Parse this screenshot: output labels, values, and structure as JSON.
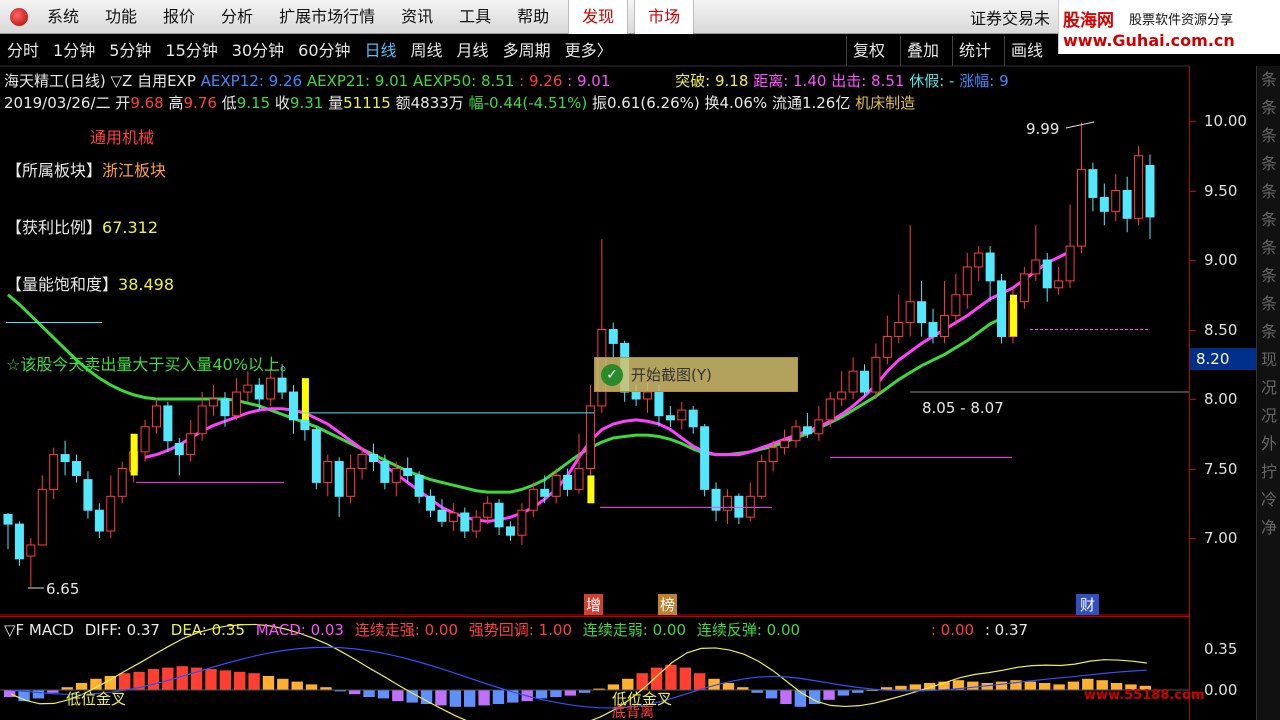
{
  "menu": {
    "items": [
      "系统",
      "功能",
      "报价",
      "分析",
      "扩展市场行情",
      "资讯",
      "工具",
      "帮助"
    ],
    "hot": [
      "发现",
      "市场"
    ],
    "right_title": "证券交易未"
  },
  "brand": {
    "name_prefix": "股海",
    "name_suffix": "网",
    "slogan": "股票软件资源分享",
    "url": "www.Guhai.com.cn"
  },
  "periods": {
    "items": [
      "分时",
      "1分钟",
      "5分钟",
      "15分钟",
      "30分钟",
      "60分钟",
      "日线",
      "周线",
      "月线",
      "多周期",
      "更多"
    ],
    "active_index": 6,
    "more_arrow": "〉"
  },
  "tools": [
    "复权",
    "叠加",
    "统计",
    "画线"
  ],
  "header": {
    "stock": "海天精工(日线)",
    "formula": "▽Z 自用EXP",
    "aexp12": "AEXP12: 9.26",
    "aexp21": "AEXP21: 9.01",
    "aexp50": "AEXP50: 8.51",
    "v1": ": 9.26",
    "v2": ": 9.01",
    "break": "突破: 9.18",
    "distance": "距离: 1.40",
    "exit": "出击: 8.51",
    "rest": "休假: -",
    "rise": "涨幅: 9"
  },
  "quote": {
    "date": "2019/03/26/二",
    "open_label": "开",
    "open": "9.68",
    "high_label": "高",
    "high": "9.76",
    "low_label": "低",
    "low": "9.15",
    "close_label": "收",
    "close": "9.31",
    "vol_label": "量",
    "vol": "51115",
    "amount": "额4833万",
    "change": "幅-0.44(-4.51%)",
    "amplitude": "振0.61(6.26%)",
    "turnover": "换4.06%",
    "float": "流通1.26亿",
    "industry": "机床制造"
  },
  "overlays": {
    "sector_tag": "通用机械",
    "block_label": "【所属板块】",
    "block_value": "浙江板块",
    "profit_label": "【获利比例】",
    "profit_value": "67.312",
    "energy_label": "【量能饱和度】",
    "energy_value": "38.498",
    "alert": "☆该股今天卖出量大于买入量40%以上。",
    "high_mark": "9.99",
    "low_mark": "6.65",
    "range_label": "8.05 - 8.07",
    "flag_zeng": "增",
    "flag_bang": "榜",
    "flag_cai": "财",
    "macd_tag1": "低位金叉",
    "macd_tag2": "低位金叉",
    "macd_tag3": "底背离"
  },
  "tooltip": {
    "label": "开始截图(Y)"
  },
  "axis": {
    "ticks": [
      "10.00",
      "9.50",
      "9.00",
      "8.50",
      "8.00",
      "7.50",
      "7.00"
    ],
    "current": "8.20",
    "macd_ticks": [
      "0.35",
      "0.00"
    ]
  },
  "sidebar": {
    "chars": [
      "条",
      "条",
      "条",
      "条",
      "条",
      "条",
      "条",
      "条",
      "条",
      "条",
      "现",
      "况",
      "况",
      "外",
      "拧",
      "冷",
      "净"
    ]
  },
  "macd": {
    "title": "▽F MACD",
    "diff": "DIFF: 0.37",
    "dea": "DEA: 0.35",
    "macd": "MACD: 0.03",
    "s1": "连续走强: 0.00",
    "s2": "强势回调: 1.00",
    "s3": "连续走弱: 0.00",
    "s4": "连续反弹: 0.00",
    "r1": ": 0.00",
    "r2": ": 0.37"
  },
  "watermark": "www.55188.com",
  "colors": {
    "up": "#ff3c3c",
    "down": "#54e8ff",
    "ma_green": "#3cd83c",
    "ma_magenta": "#ff40ff",
    "ma_blue": "#3050ff",
    "axis_red": "#c00000",
    "highlight_yellow": "#ffff00"
  },
  "price_scale": {
    "min": 6.6,
    "max": 10.0
  },
  "candles": [
    [
      7.17,
      7.1,
      7.18,
      6.92
    ],
    [
      7.1,
      6.85,
      7.12,
      6.8
    ],
    [
      6.87,
      6.95,
      7.0,
      6.65
    ],
    [
      6.95,
      7.35,
      7.45,
      6.95
    ],
    [
      7.35,
      7.6,
      7.65,
      7.28
    ],
    [
      7.6,
      7.55,
      7.7,
      7.45
    ],
    [
      7.55,
      7.45,
      7.6,
      7.4
    ],
    [
      7.42,
      7.2,
      7.48,
      7.14
    ],
    [
      7.2,
      7.05,
      7.25,
      7.0
    ],
    [
      7.05,
      7.3,
      7.45,
      7.0
    ],
    [
      7.3,
      7.5,
      7.55,
      7.25
    ],
    [
      7.48,
      7.62,
      7.7,
      7.4
    ],
    [
      7.62,
      7.8,
      7.85,
      7.55
    ],
    [
      7.8,
      7.95,
      8.0,
      7.75
    ],
    [
      7.95,
      7.7,
      7.98,
      7.62
    ],
    [
      7.68,
      7.6,
      7.72,
      7.45
    ],
    [
      7.6,
      7.75,
      7.85,
      7.55
    ],
    [
      7.75,
      7.95,
      8.05,
      7.7
    ],
    [
      7.95,
      8.0,
      8.1,
      7.88
    ],
    [
      8.0,
      7.88,
      8.05,
      7.8
    ],
    [
      7.88,
      8.05,
      8.15,
      7.85
    ],
    [
      8.05,
      8.1,
      8.2,
      7.98
    ],
    [
      8.1,
      8.0,
      8.15,
      7.92
    ],
    [
      8.0,
      8.15,
      8.22,
      7.95
    ],
    [
      8.15,
      8.05,
      8.25,
      8.0
    ],
    [
      8.05,
      7.85,
      8.1,
      7.75
    ],
    [
      7.85,
      7.78,
      7.9,
      7.7
    ],
    [
      7.78,
      7.4,
      7.8,
      7.35
    ],
    [
      7.4,
      7.55,
      7.6,
      7.3
    ],
    [
      7.55,
      7.3,
      7.58,
      7.15
    ],
    [
      7.3,
      7.5,
      7.6,
      7.25
    ],
    [
      7.5,
      7.6,
      7.65,
      7.42
    ],
    [
      7.6,
      7.55,
      7.68,
      7.48
    ],
    [
      7.55,
      7.4,
      7.6,
      7.35
    ],
    [
      7.4,
      7.5,
      7.55,
      7.3
    ],
    [
      7.5,
      7.45,
      7.58,
      7.4
    ],
    [
      7.45,
      7.3,
      7.48,
      7.25
    ],
    [
      7.3,
      7.2,
      7.35,
      7.15
    ],
    [
      7.2,
      7.12,
      7.28,
      7.08
    ],
    [
      7.12,
      7.18,
      7.25,
      7.05
    ],
    [
      7.18,
      7.05,
      7.22,
      7.0
    ],
    [
      7.05,
      7.15,
      7.2,
      7.0
    ],
    [
      7.15,
      7.25,
      7.3,
      7.1
    ],
    [
      7.25,
      7.08,
      7.28,
      7.02
    ],
    [
      7.08,
      7.02,
      7.12,
      6.98
    ],
    [
      7.02,
      7.2,
      7.25,
      6.95
    ],
    [
      7.2,
      7.35,
      7.4,
      7.15
    ],
    [
      7.35,
      7.3,
      7.45,
      7.25
    ],
    [
      7.3,
      7.45,
      7.5,
      7.25
    ],
    [
      7.45,
      7.35,
      7.5,
      7.3
    ],
    [
      7.35,
      7.5,
      7.75,
      7.32
    ],
    [
      7.5,
      7.95,
      8.1,
      7.45
    ],
    [
      7.95,
      8.5,
      9.15,
      7.9
    ],
    [
      8.5,
      8.4,
      8.55,
      8.3
    ],
    [
      8.4,
      8.05,
      8.42,
      7.98
    ],
    [
      8.05,
      8.0,
      8.1,
      7.95
    ],
    [
      8.0,
      8.05,
      8.12,
      7.9
    ],
    [
      8.05,
      7.88,
      8.1,
      7.8
    ],
    [
      7.88,
      7.85,
      7.95,
      7.8
    ],
    [
      7.85,
      7.92,
      7.98,
      7.78
    ],
    [
      7.92,
      7.8,
      7.95,
      7.75
    ],
    [
      7.8,
      7.35,
      7.82,
      7.3
    ],
    [
      7.35,
      7.2,
      7.4,
      7.12
    ],
    [
      7.2,
      7.3,
      7.35,
      7.1
    ],
    [
      7.3,
      7.15,
      7.32,
      7.1
    ],
    [
      7.15,
      7.3,
      7.4,
      7.12
    ],
    [
      7.3,
      7.55,
      7.6,
      7.28
    ],
    [
      7.55,
      7.65,
      7.7,
      7.48
    ],
    [
      7.65,
      7.7,
      7.78,
      7.6
    ],
    [
      7.7,
      7.8,
      7.85,
      7.65
    ],
    [
      7.8,
      7.75,
      7.9,
      7.72
    ],
    [
      7.75,
      7.85,
      7.95,
      7.7
    ],
    [
      7.85,
      8.0,
      8.05,
      7.8
    ],
    [
      8.0,
      8.05,
      8.2,
      7.95
    ],
    [
      8.05,
      8.2,
      8.3,
      8.0
    ],
    [
      8.2,
      8.05,
      8.25,
      8.02
    ],
    [
      8.05,
      8.3,
      8.4,
      8.0
    ],
    [
      8.3,
      8.45,
      8.6,
      8.25
    ],
    [
      8.45,
      8.55,
      8.75,
      8.4
    ],
    [
      8.55,
      8.7,
      9.25,
      8.45
    ],
    [
      8.7,
      8.55,
      8.85,
      8.45
    ],
    [
      8.55,
      8.45,
      8.65,
      8.4
    ],
    [
      8.45,
      8.6,
      8.85,
      8.4
    ],
    [
      8.6,
      8.75,
      8.9,
      8.55
    ],
    [
      8.75,
      8.95,
      9.05,
      8.65
    ],
    [
      8.95,
      9.05,
      9.1,
      8.85
    ],
    [
      9.05,
      8.85,
      9.1,
      8.7
    ],
    [
      8.85,
      8.45,
      8.9,
      8.4
    ],
    [
      8.45,
      8.7,
      8.8,
      8.4
    ],
    [
      8.7,
      8.9,
      8.95,
      8.65
    ],
    [
      8.9,
      9.0,
      9.25,
      8.85
    ],
    [
      9.0,
      8.8,
      9.05,
      8.7
    ],
    [
      8.8,
      8.85,
      8.95,
      8.75
    ],
    [
      8.85,
      9.1,
      9.4,
      8.8
    ],
    [
      9.1,
      9.65,
      9.99,
      9.05
    ],
    [
      9.65,
      9.45,
      9.7,
      9.35
    ],
    [
      9.45,
      9.35,
      9.55,
      9.25
    ],
    [
      9.35,
      9.5,
      9.62,
      9.28
    ],
    [
      9.5,
      9.3,
      9.6,
      9.2
    ],
    [
      9.3,
      9.75,
      9.82,
      9.25
    ],
    [
      9.68,
      9.31,
      9.76,
      9.15
    ]
  ],
  "ma": {
    "magenta": [
      null,
      null,
      null,
      null,
      null,
      null,
      null,
      null,
      null,
      null,
      null,
      null,
      7.58,
      7.6,
      7.63,
      7.67,
      7.72,
      7.77,
      7.81,
      7.84,
      7.87,
      7.9,
      7.92,
      7.93,
      7.93,
      7.92,
      7.9,
      7.86,
      7.82,
      7.76,
      7.7,
      7.64,
      7.58,
      7.52,
      7.46,
      7.4,
      7.34,
      7.28,
      7.22,
      7.18,
      7.15,
      7.13,
      7.12,
      7.13,
      7.15,
      7.18,
      7.22,
      7.28,
      7.35,
      7.45,
      7.58,
      7.7,
      7.78,
      7.82,
      7.84,
      7.85,
      7.84,
      7.82,
      7.78,
      7.72,
      7.66,
      7.62,
      7.6,
      7.6,
      7.6,
      7.62,
      7.65,
      7.68,
      7.71,
      7.74,
      7.77,
      7.8,
      7.84,
      7.89,
      7.95,
      8.02,
      8.1,
      8.2,
      8.28,
      8.34,
      8.4,
      8.45,
      8.5,
      8.55,
      8.6,
      8.66,
      8.72,
      8.76,
      8.8,
      8.86,
      8.92,
      8.98,
      9.02,
      9.06
    ],
    "green": [
      8.75,
      8.68,
      8.6,
      8.52,
      8.44,
      8.36,
      8.28,
      8.21,
      8.15,
      8.1,
      8.06,
      8.03,
      8.01,
      8.0,
      8.0,
      8.0,
      8.0,
      8.0,
      8.0,
      8.0,
      7.99,
      7.97,
      7.95,
      7.92,
      7.89,
      7.86,
      7.83,
      7.8,
      7.76,
      7.72,
      7.68,
      7.64,
      7.6,
      7.56,
      7.52,
      7.48,
      7.45,
      7.42,
      7.4,
      7.38,
      7.36,
      7.34,
      7.33,
      7.33,
      7.33,
      7.35,
      7.38,
      7.42,
      7.48,
      7.54,
      7.6,
      7.65,
      7.69,
      7.72,
      7.73,
      7.74,
      7.74,
      7.73,
      7.71,
      7.68,
      7.64,
      7.61,
      7.6,
      7.6,
      7.61,
      7.62,
      7.64,
      7.66,
      7.69,
      7.72,
      7.75,
      7.79,
      7.83,
      7.87,
      7.92,
      7.97,
      8.02,
      8.08,
      8.14,
      8.19,
      8.24,
      8.28,
      8.32,
      8.37,
      8.42,
      8.48,
      8.54,
      8.58
    ]
  },
  "macd_bars": [
    -0.05,
    -0.08,
    -0.06,
    -0.02,
    0.02,
    0.05,
    0.08,
    0.1,
    0.12,
    0.13,
    0.15,
    0.16,
    0.17,
    0.16,
    0.15,
    0.14,
    0.13,
    0.12,
    0.1,
    0.08,
    0.06,
    0.04,
    0.02,
    -0.01,
    -0.03,
    -0.05,
    -0.06,
    -0.08,
    -0.09,
    -0.1,
    -0.11,
    -0.12,
    -0.12,
    -0.11,
    -0.1,
    -0.09,
    -0.08,
    -0.06,
    -0.05,
    -0.04,
    -0.02,
    0.01,
    0.04,
    0.08,
    0.12,
    0.16,
    0.18,
    0.16,
    0.12,
    0.08,
    0.05,
    0.02,
    -0.02,
    -0.06,
    -0.1,
    -0.12,
    -0.1,
    -0.07,
    -0.04,
    -0.02,
    0.0,
    0.02,
    0.03,
    0.04,
    0.05,
    0.06,
    0.07,
    0.06,
    0.05,
    0.06,
    0.07,
    0.06,
    0.05,
    0.04,
    0.06,
    0.08,
    0.07,
    0.05,
    0.04,
    0.03
  ]
}
